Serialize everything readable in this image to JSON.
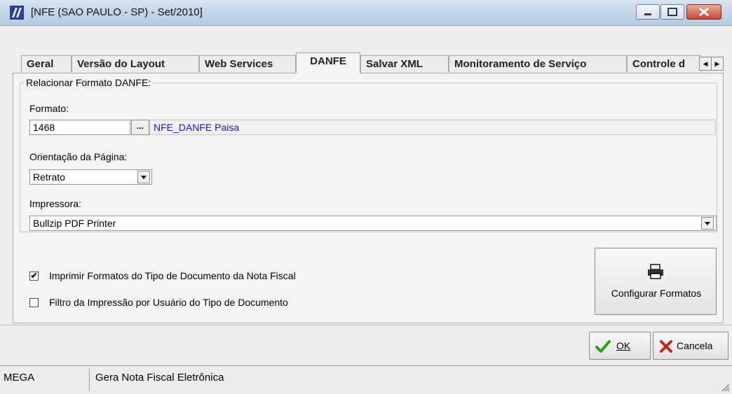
{
  "window": {
    "title": "[NFE (SAO PAULO - SP) - Set/2010]"
  },
  "tabs": [
    {
      "label": "Geral"
    },
    {
      "label": "Versão do Layout"
    },
    {
      "label": "Web Services"
    },
    {
      "label": "DANFE",
      "active": true
    },
    {
      "label": "Salvar XML"
    },
    {
      "label": "Monitoramento de Serviço"
    },
    {
      "label": "Controle d"
    }
  ],
  "group": {
    "legend": "Relacionar Formato DANFE:",
    "formato_label": "Formato:",
    "formato_value": "1468",
    "formato_button": "...",
    "formato_desc": "NFE_DANFE Paisa",
    "orientacao_label": "Orientação da Página:",
    "orientacao_value": "Retrato",
    "impressora_label": "Impressora:",
    "impressora_value": "Bullzip PDF Printer"
  },
  "options": {
    "imprimir_label": "Imprimir Formatos do Tipo de Documento da Nota Fiscal",
    "imprimir_checked": true,
    "filtro_label": "Filtro da Impressão por Usuário do Tipo de Documento",
    "filtro_checked": false
  },
  "config_button": {
    "label": "Configurar Formatos",
    "icon": "printer-icon"
  },
  "buttons": {
    "ok": "OK",
    "cancel": "Cancela"
  },
  "status": {
    "left": "MEGA",
    "right": "Gera Nota Fiscal Eletrônica"
  },
  "colors": {
    "desc_text": "#1a1aa8",
    "ok_check": "#2f9a1d",
    "cancel_x": "#c0271a"
  }
}
